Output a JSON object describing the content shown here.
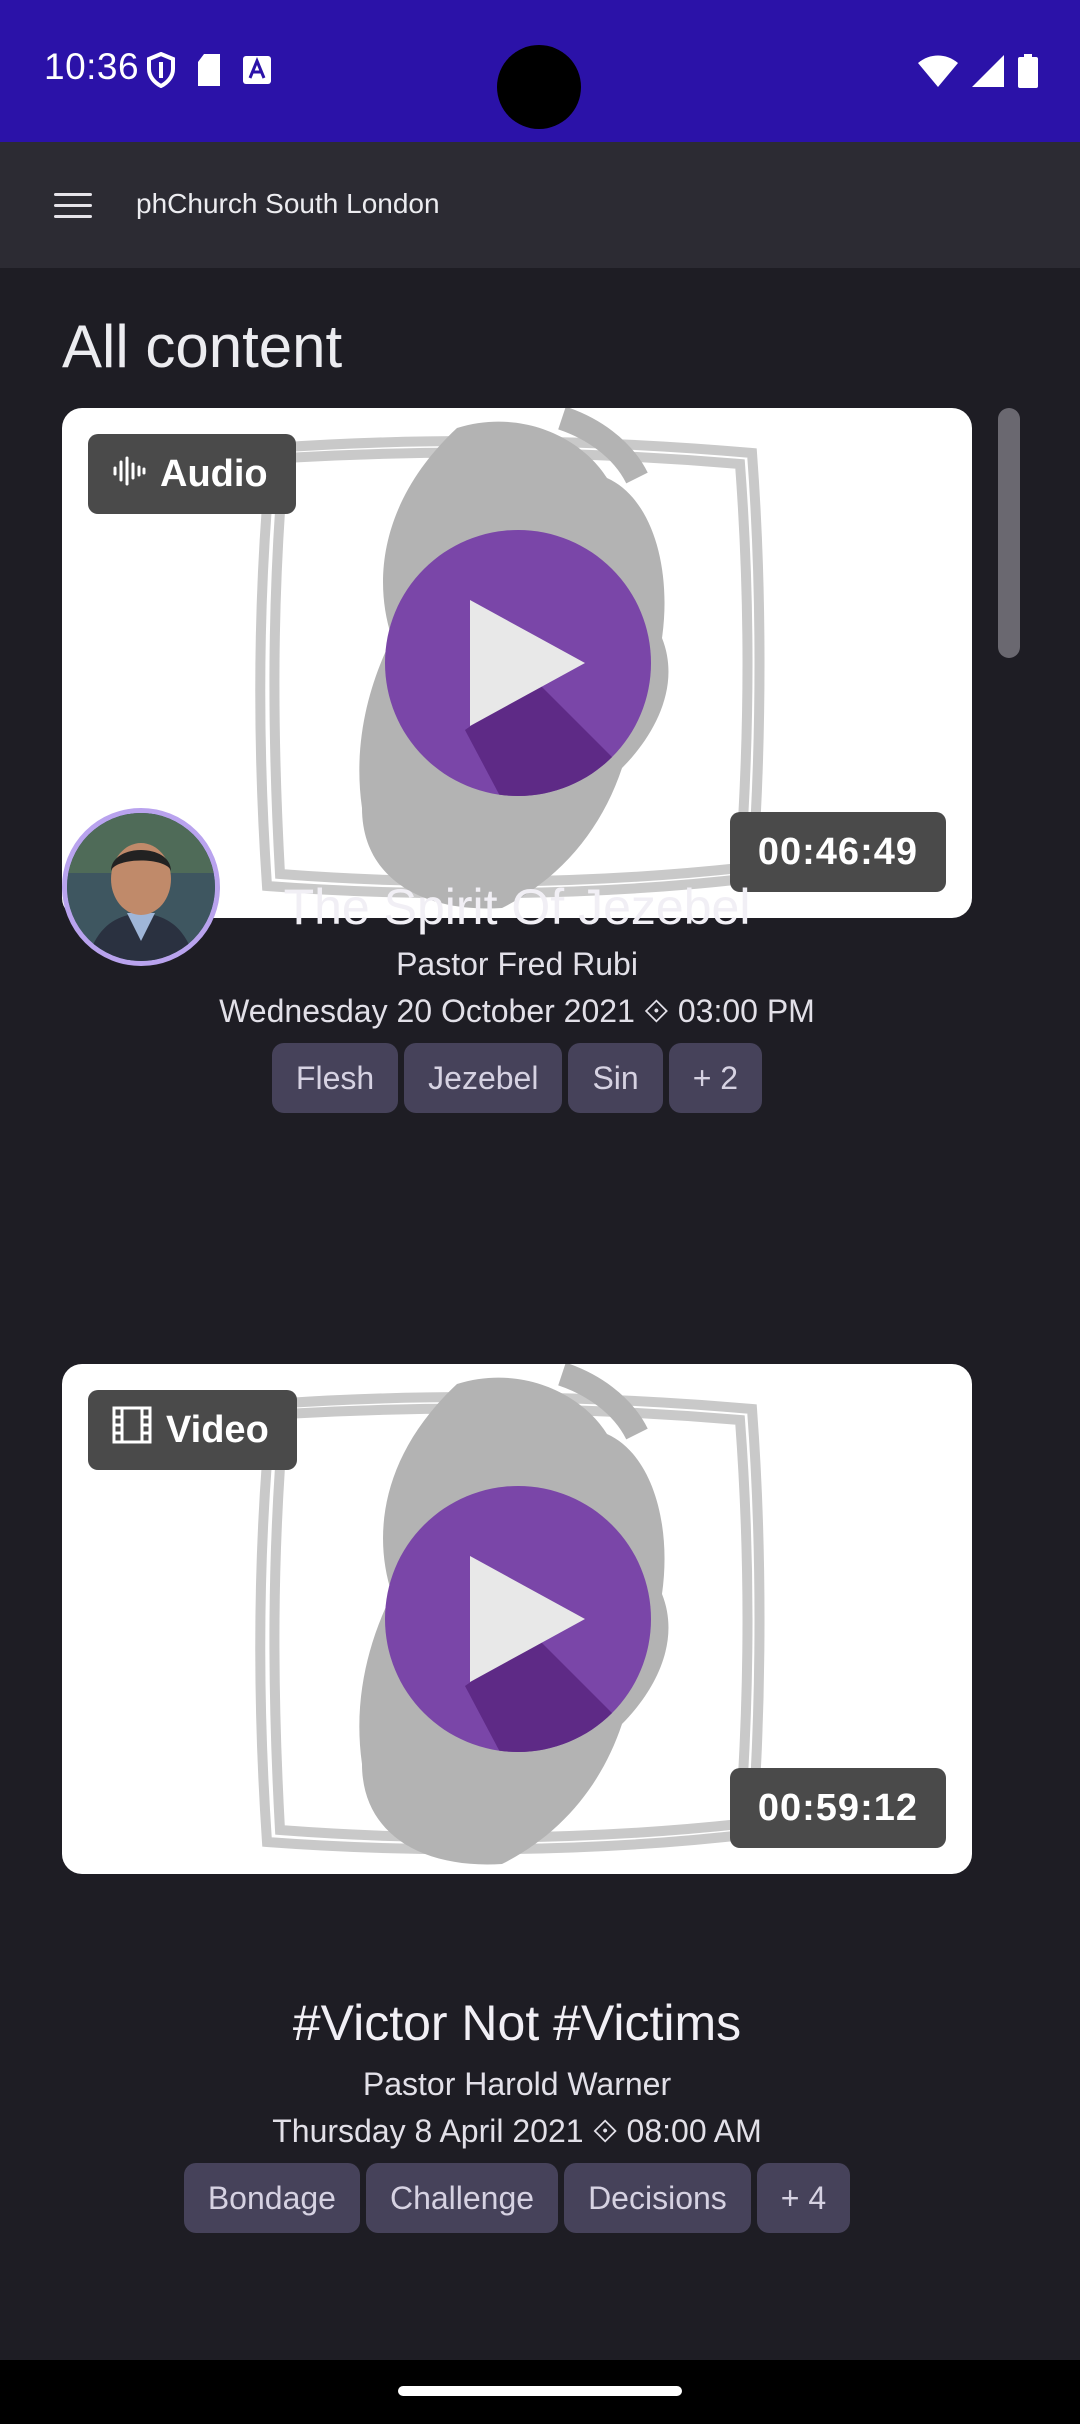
{
  "status_bar": {
    "time": "10:36",
    "left_icons": [
      "shield-icon",
      "sd-card-icon",
      "font-icon"
    ],
    "right_icons": [
      "wifi-icon",
      "signal-icon",
      "battery-icon"
    ],
    "background": "#2b12a8"
  },
  "app_bar": {
    "title": "phChurch South London"
  },
  "page": {
    "heading": "All content"
  },
  "items": [
    {
      "type_label": "Audio",
      "type_icon": "audio-wave-icon",
      "duration": "00:46:49",
      "title": "The Spirit Of Jezebel",
      "speaker": "Pastor Fred Rubi",
      "date": "Wednesday 20 October 2021 ⟐ 03:00 PM",
      "tags": [
        "Flesh",
        "Jezebel",
        "Sin",
        "+ 2"
      ],
      "has_avatar": true
    },
    {
      "type_label": "Video",
      "type_icon": "film-icon",
      "duration": "00:59:12",
      "title": "#Victor Not #Victims",
      "speaker": "Pastor Harold Warner",
      "date": "Thursday 8 April 2021 ⟐ 08:00 AM",
      "tags": [
        "Bondage",
        "Challenge",
        "Decisions",
        "+ 4"
      ],
      "has_avatar": false
    }
  ],
  "colors": {
    "accent": "#7a46a8",
    "background": "#1e1d24",
    "chip": "#46425a"
  }
}
